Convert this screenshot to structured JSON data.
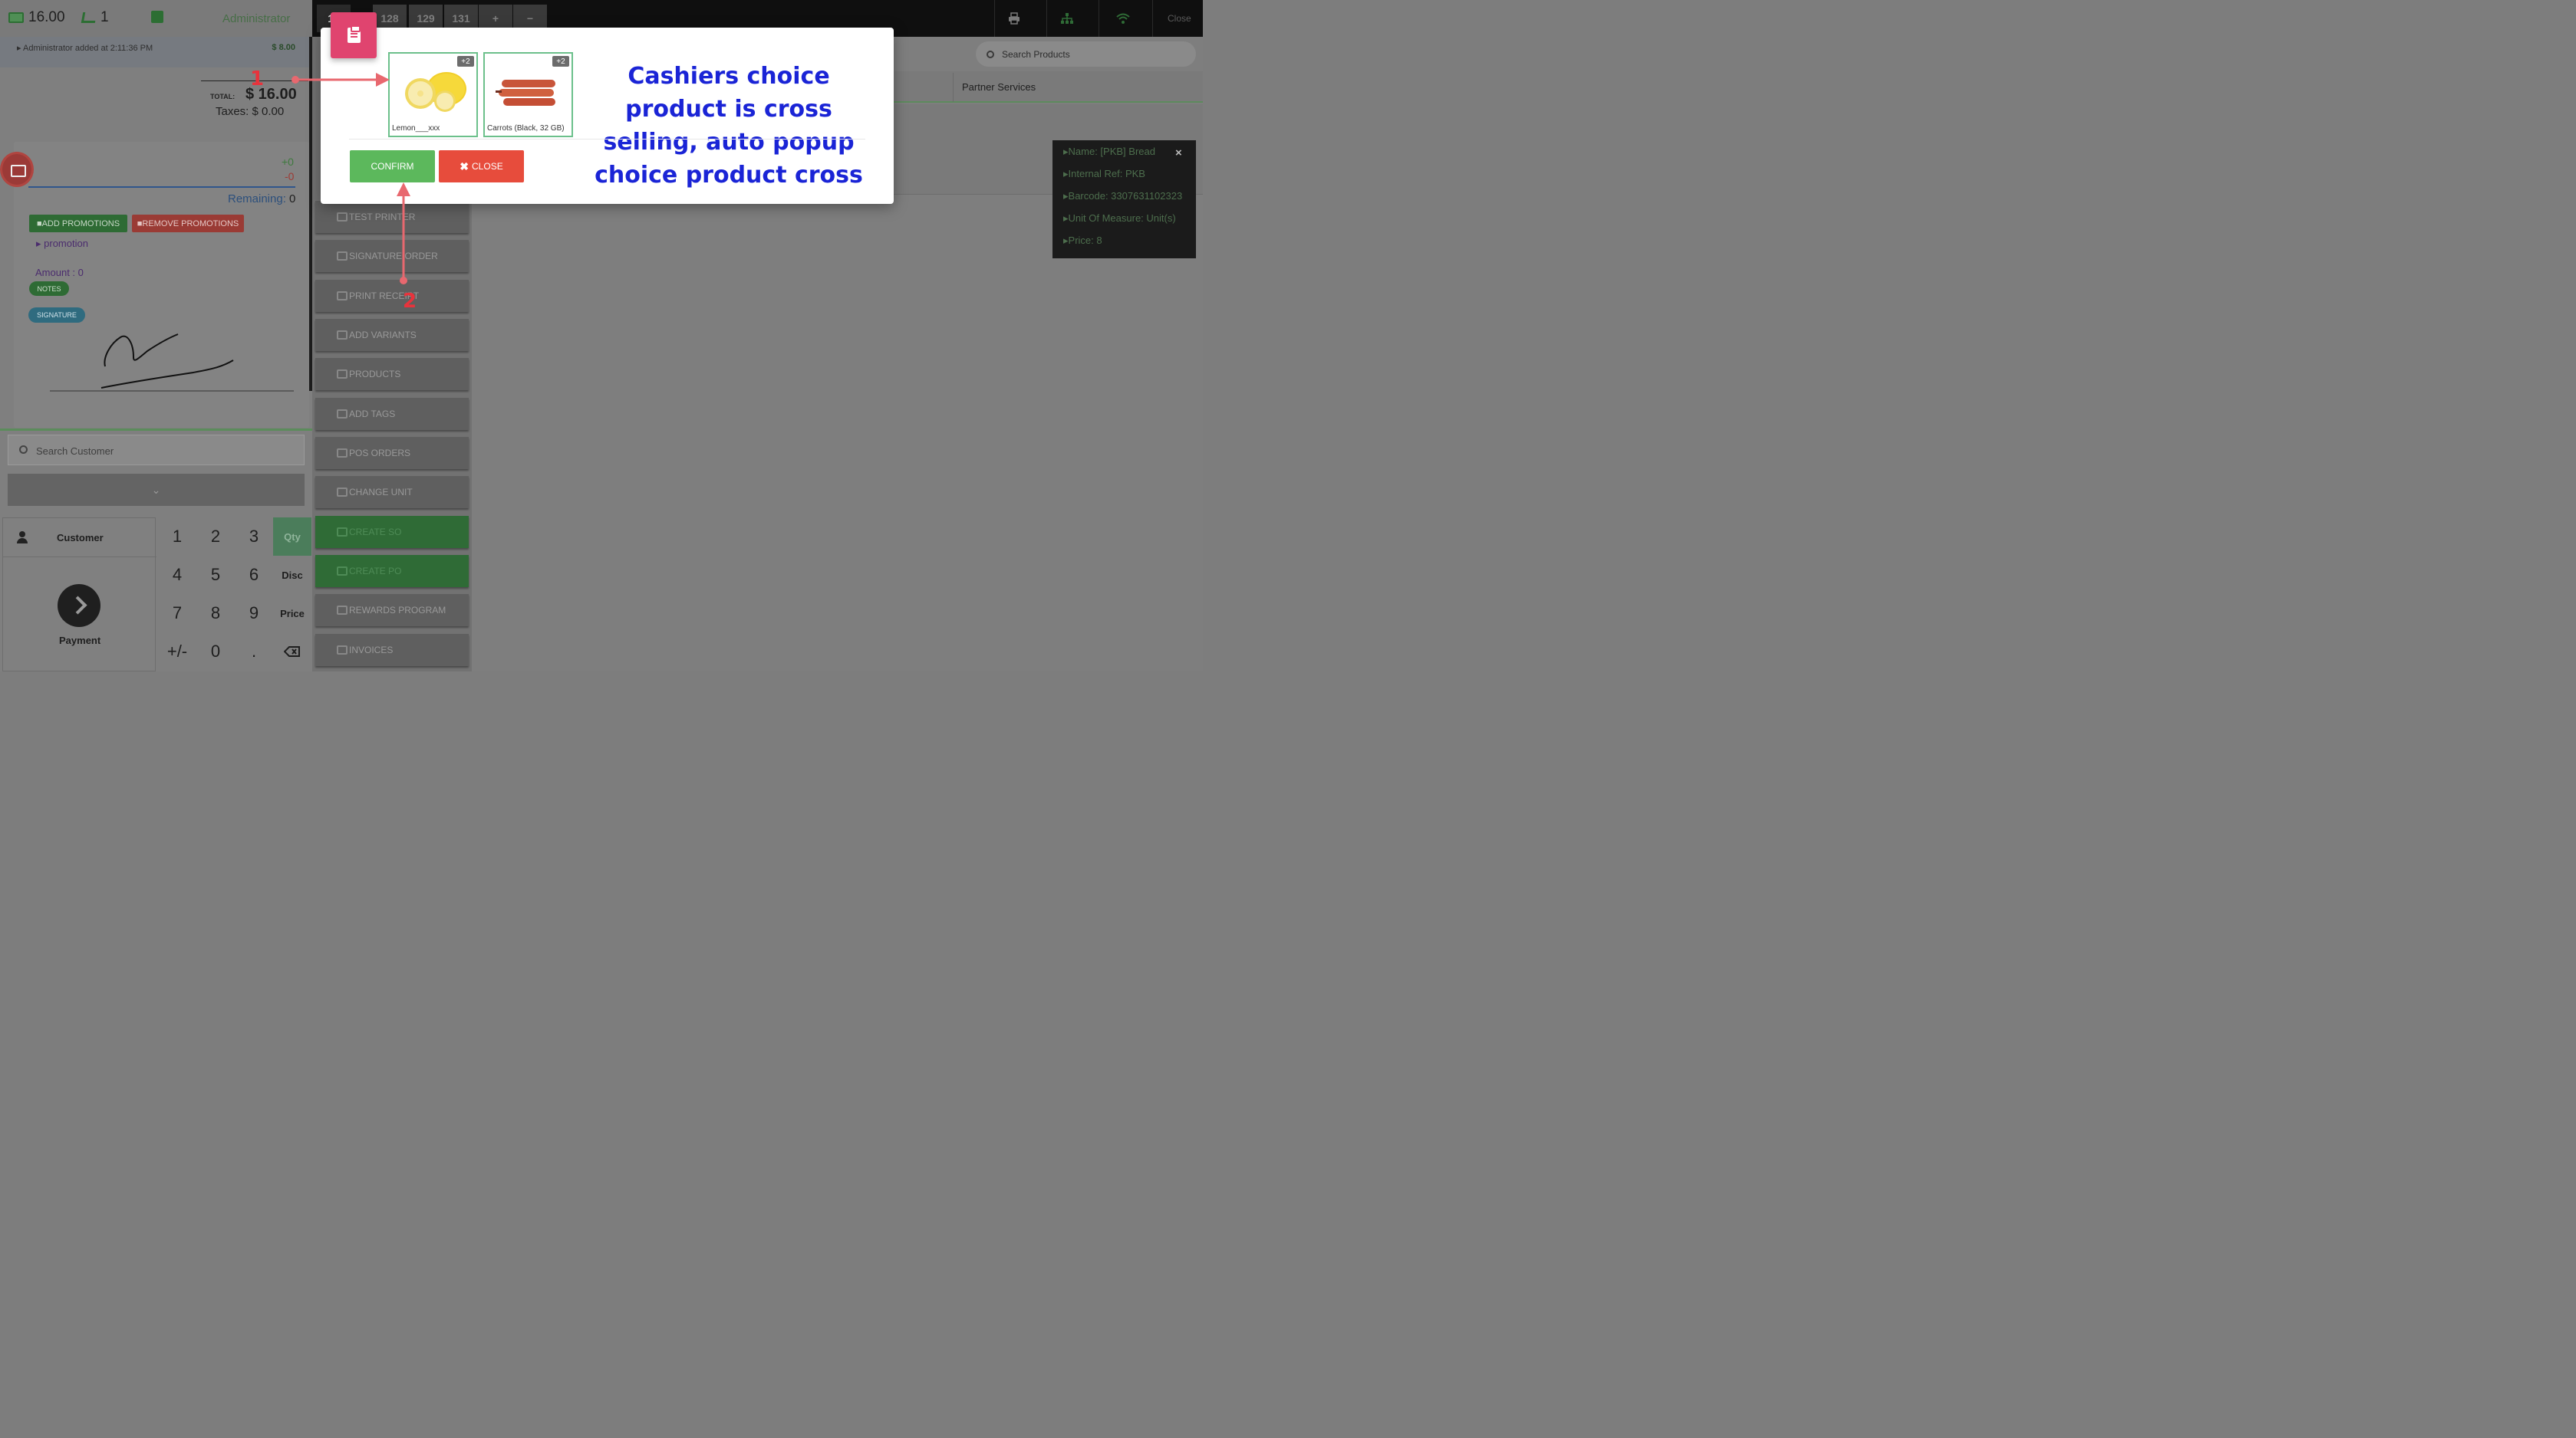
{
  "topbar": {
    "cash_amount": "16.00",
    "cart_count": "1",
    "user": "Administrator"
  },
  "order": {
    "line_text": "Administrator added at 2:11:36 PM",
    "line_price": "$ 8.00",
    "total_label": "TOTAL:",
    "total_value": "$ 16.00",
    "taxes": "Taxes: $ 0.00"
  },
  "payment": {
    "plus": "+0",
    "minus": "-0",
    "remaining_label": "Remaining:",
    "remaining_value": "0",
    "add_promotions": "ADD PROMOTIONS",
    "remove_promotions": "REMOVE PROMOTIONS",
    "promotion": "promotion",
    "amount": "Amount : 0",
    "notes": "NOTES",
    "signature": "SIGNATURE"
  },
  "customer": {
    "search_placeholder": "Search Customer",
    "label": "Customer",
    "payment_label": "Payment"
  },
  "numpad": {
    "keys": [
      "1",
      "2",
      "3",
      "4",
      "5",
      "6",
      "7",
      "8",
      "9",
      "+/-",
      "0",
      "."
    ],
    "modes": [
      "Qty",
      "Disc",
      "Price"
    ],
    "active_mode": "Qty"
  },
  "actions": [
    {
      "label": "TEST PRINTER",
      "icon": "bug-icon",
      "style": "grey"
    },
    {
      "label": "SIGNATURE ORDER",
      "icon": "edit-icon",
      "style": "grey"
    },
    {
      "label": "PRINT RECEIPT",
      "icon": "print-icon",
      "style": "grey"
    },
    {
      "label": "ADD VARIANTS",
      "icon": "sliders-icon",
      "style": "grey"
    },
    {
      "label": "PRODUCTS",
      "icon": "edit-icon",
      "style": "grey"
    },
    {
      "label": "ADD TAGS",
      "icon": "sliders-icon",
      "style": "grey"
    },
    {
      "label": "POS ORDERS",
      "icon": "search-icon",
      "style": "grey"
    },
    {
      "label": "CHANGE UNIT",
      "icon": "sliders-icon",
      "style": "grey"
    },
    {
      "label": "CREATE SO",
      "icon": "cart-icon",
      "style": "green"
    },
    {
      "label": "CREATE PO",
      "icon": "cart-icon",
      "style": "green"
    },
    {
      "label": "REWARDS PROGRAM",
      "icon": "gift-icon",
      "style": "grey"
    },
    {
      "label": "INVOICES",
      "icon": "search-icon",
      "style": "grey"
    }
  ],
  "tabs": {
    "items": [
      "12",
      "128",
      "129",
      "131",
      "+",
      "−"
    ],
    "close_label": "Close"
  },
  "products": {
    "search_placeholder": "Search Products",
    "category": "Partner Services"
  },
  "product_info": {
    "lines": [
      "Name: [PKB] Bread",
      "Internal Ref: PKB",
      "Barcode: 3307631102323",
      "Unit Of Measure: Unit(s)",
      "Price: 8"
    ],
    "close_icon": "×"
  },
  "modal": {
    "products": [
      {
        "name": "Lemon___xxx",
        "badge": "+2",
        "image": "lemon"
      },
      {
        "name": "Carrots (Black, 32 GB)",
        "badge": "+2",
        "image": "carrot"
      }
    ],
    "confirm": "CONFIRM",
    "close": "CLOSE",
    "annotation": "Cashiers choice product is cross selling, auto popup choice product cross"
  },
  "markers": {
    "one": "1",
    "two": "2"
  },
  "colors": {
    "confirm": "#5cb85c",
    "close": "#e74c3c",
    "badge": "#e0446f",
    "annotation": "#1a24d6",
    "marker": "#e8333c"
  }
}
